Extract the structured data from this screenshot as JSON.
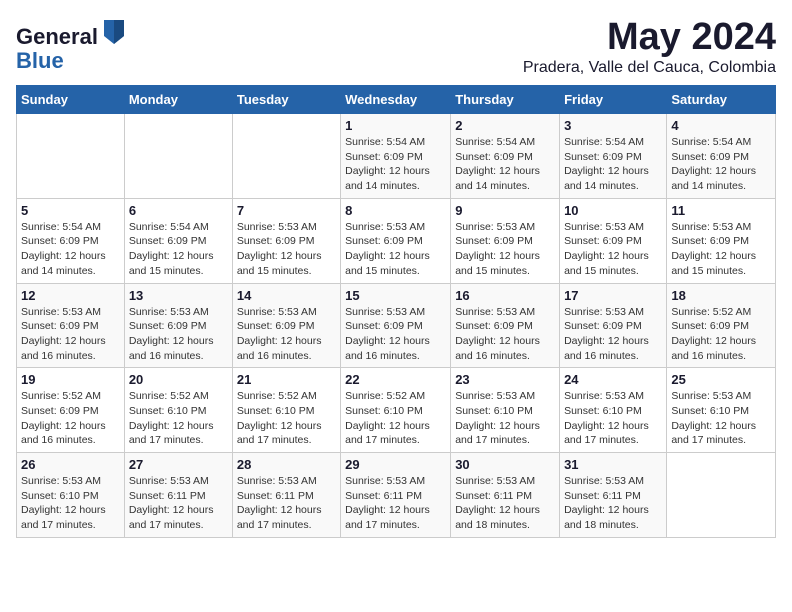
{
  "logo": {
    "general": "General",
    "blue": "Blue"
  },
  "title": "May 2024",
  "subtitle": "Pradera, Valle del Cauca, Colombia",
  "days_of_week": [
    "Sunday",
    "Monday",
    "Tuesday",
    "Wednesday",
    "Thursday",
    "Friday",
    "Saturday"
  ],
  "weeks": [
    [
      {
        "day": "",
        "info": ""
      },
      {
        "day": "",
        "info": ""
      },
      {
        "day": "",
        "info": ""
      },
      {
        "day": "1",
        "info": "Sunrise: 5:54 AM\nSunset: 6:09 PM\nDaylight: 12 hours and 14 minutes."
      },
      {
        "day": "2",
        "info": "Sunrise: 5:54 AM\nSunset: 6:09 PM\nDaylight: 12 hours and 14 minutes."
      },
      {
        "day": "3",
        "info": "Sunrise: 5:54 AM\nSunset: 6:09 PM\nDaylight: 12 hours and 14 minutes."
      },
      {
        "day": "4",
        "info": "Sunrise: 5:54 AM\nSunset: 6:09 PM\nDaylight: 12 hours and 14 minutes."
      }
    ],
    [
      {
        "day": "5",
        "info": "Sunrise: 5:54 AM\nSunset: 6:09 PM\nDaylight: 12 hours and 14 minutes."
      },
      {
        "day": "6",
        "info": "Sunrise: 5:54 AM\nSunset: 6:09 PM\nDaylight: 12 hours and 15 minutes."
      },
      {
        "day": "7",
        "info": "Sunrise: 5:53 AM\nSunset: 6:09 PM\nDaylight: 12 hours and 15 minutes."
      },
      {
        "day": "8",
        "info": "Sunrise: 5:53 AM\nSunset: 6:09 PM\nDaylight: 12 hours and 15 minutes."
      },
      {
        "day": "9",
        "info": "Sunrise: 5:53 AM\nSunset: 6:09 PM\nDaylight: 12 hours and 15 minutes."
      },
      {
        "day": "10",
        "info": "Sunrise: 5:53 AM\nSunset: 6:09 PM\nDaylight: 12 hours and 15 minutes."
      },
      {
        "day": "11",
        "info": "Sunrise: 5:53 AM\nSunset: 6:09 PM\nDaylight: 12 hours and 15 minutes."
      }
    ],
    [
      {
        "day": "12",
        "info": "Sunrise: 5:53 AM\nSunset: 6:09 PM\nDaylight: 12 hours and 16 minutes."
      },
      {
        "day": "13",
        "info": "Sunrise: 5:53 AM\nSunset: 6:09 PM\nDaylight: 12 hours and 16 minutes."
      },
      {
        "day": "14",
        "info": "Sunrise: 5:53 AM\nSunset: 6:09 PM\nDaylight: 12 hours and 16 minutes."
      },
      {
        "day": "15",
        "info": "Sunrise: 5:53 AM\nSunset: 6:09 PM\nDaylight: 12 hours and 16 minutes."
      },
      {
        "day": "16",
        "info": "Sunrise: 5:53 AM\nSunset: 6:09 PM\nDaylight: 12 hours and 16 minutes."
      },
      {
        "day": "17",
        "info": "Sunrise: 5:53 AM\nSunset: 6:09 PM\nDaylight: 12 hours and 16 minutes."
      },
      {
        "day": "18",
        "info": "Sunrise: 5:52 AM\nSunset: 6:09 PM\nDaylight: 12 hours and 16 minutes."
      }
    ],
    [
      {
        "day": "19",
        "info": "Sunrise: 5:52 AM\nSunset: 6:09 PM\nDaylight: 12 hours and 16 minutes."
      },
      {
        "day": "20",
        "info": "Sunrise: 5:52 AM\nSunset: 6:10 PM\nDaylight: 12 hours and 17 minutes."
      },
      {
        "day": "21",
        "info": "Sunrise: 5:52 AM\nSunset: 6:10 PM\nDaylight: 12 hours and 17 minutes."
      },
      {
        "day": "22",
        "info": "Sunrise: 5:52 AM\nSunset: 6:10 PM\nDaylight: 12 hours and 17 minutes."
      },
      {
        "day": "23",
        "info": "Sunrise: 5:53 AM\nSunset: 6:10 PM\nDaylight: 12 hours and 17 minutes."
      },
      {
        "day": "24",
        "info": "Sunrise: 5:53 AM\nSunset: 6:10 PM\nDaylight: 12 hours and 17 minutes."
      },
      {
        "day": "25",
        "info": "Sunrise: 5:53 AM\nSunset: 6:10 PM\nDaylight: 12 hours and 17 minutes."
      }
    ],
    [
      {
        "day": "26",
        "info": "Sunrise: 5:53 AM\nSunset: 6:10 PM\nDaylight: 12 hours and 17 minutes."
      },
      {
        "day": "27",
        "info": "Sunrise: 5:53 AM\nSunset: 6:11 PM\nDaylight: 12 hours and 17 minutes."
      },
      {
        "day": "28",
        "info": "Sunrise: 5:53 AM\nSunset: 6:11 PM\nDaylight: 12 hours and 17 minutes."
      },
      {
        "day": "29",
        "info": "Sunrise: 5:53 AM\nSunset: 6:11 PM\nDaylight: 12 hours and 17 minutes."
      },
      {
        "day": "30",
        "info": "Sunrise: 5:53 AM\nSunset: 6:11 PM\nDaylight: 12 hours and 18 minutes."
      },
      {
        "day": "31",
        "info": "Sunrise: 5:53 AM\nSunset: 6:11 PM\nDaylight: 12 hours and 18 minutes."
      },
      {
        "day": "",
        "info": ""
      }
    ]
  ]
}
